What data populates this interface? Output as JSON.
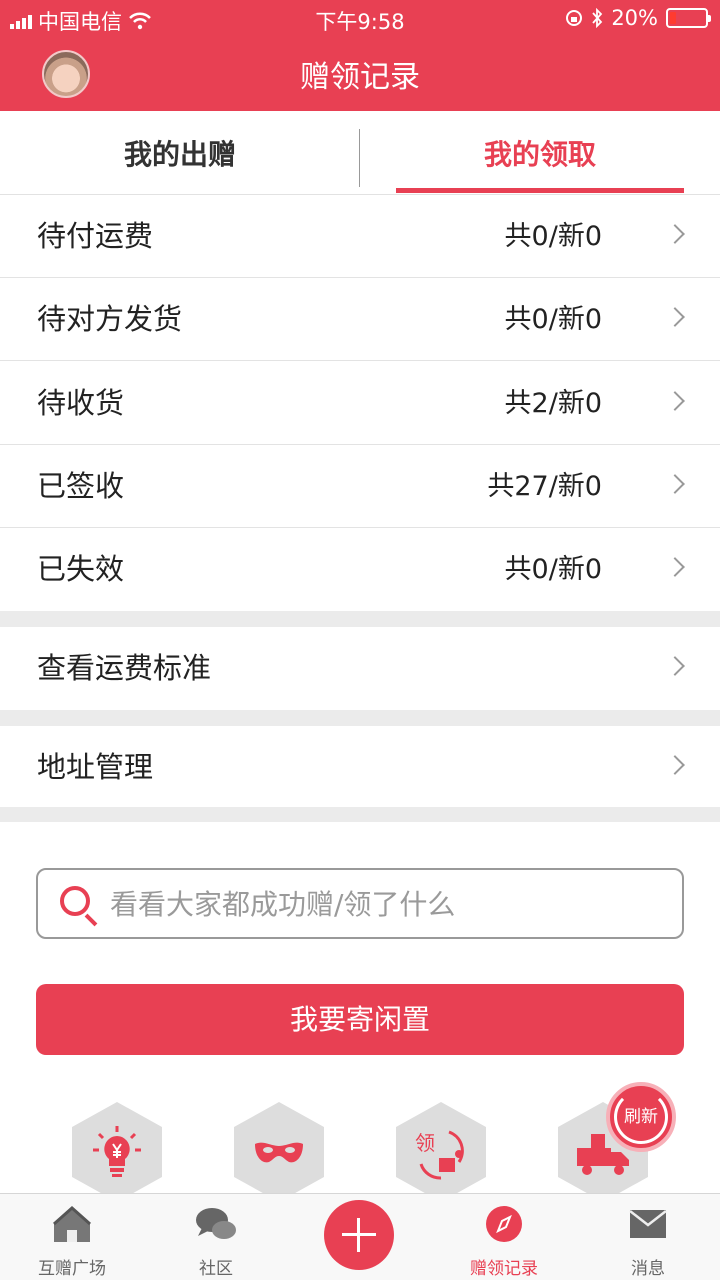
{
  "status": {
    "carrier": "中国电信",
    "time": "下午9:58",
    "battery": "20%"
  },
  "header": {
    "title": "赠领记录"
  },
  "tabs": [
    {
      "label": "我的出赠"
    },
    {
      "label": "我的领取"
    }
  ],
  "rows": [
    {
      "label": "待付运费",
      "count": "共0/新0"
    },
    {
      "label": "待对方发货",
      "count": "共0/新0"
    },
    {
      "label": "待收货",
      "count": "共2/新0"
    },
    {
      "label": "已签收",
      "count": "共27/新0"
    },
    {
      "label": "已失效",
      "count": "共0/新0"
    }
  ],
  "links": [
    {
      "label": "查看运费标准"
    },
    {
      "label": "地址管理"
    }
  ],
  "search": {
    "placeholder": "看看大家都成功赠/领了什么"
  },
  "post_button": "我要寄闲置",
  "refresh_label": "刷新",
  "bottom_nav": [
    {
      "label": "互赠广场"
    },
    {
      "label": "社区"
    },
    {
      "label": "赠领记录"
    },
    {
      "label": "消息"
    }
  ],
  "colors": {
    "accent": "#e84053"
  }
}
